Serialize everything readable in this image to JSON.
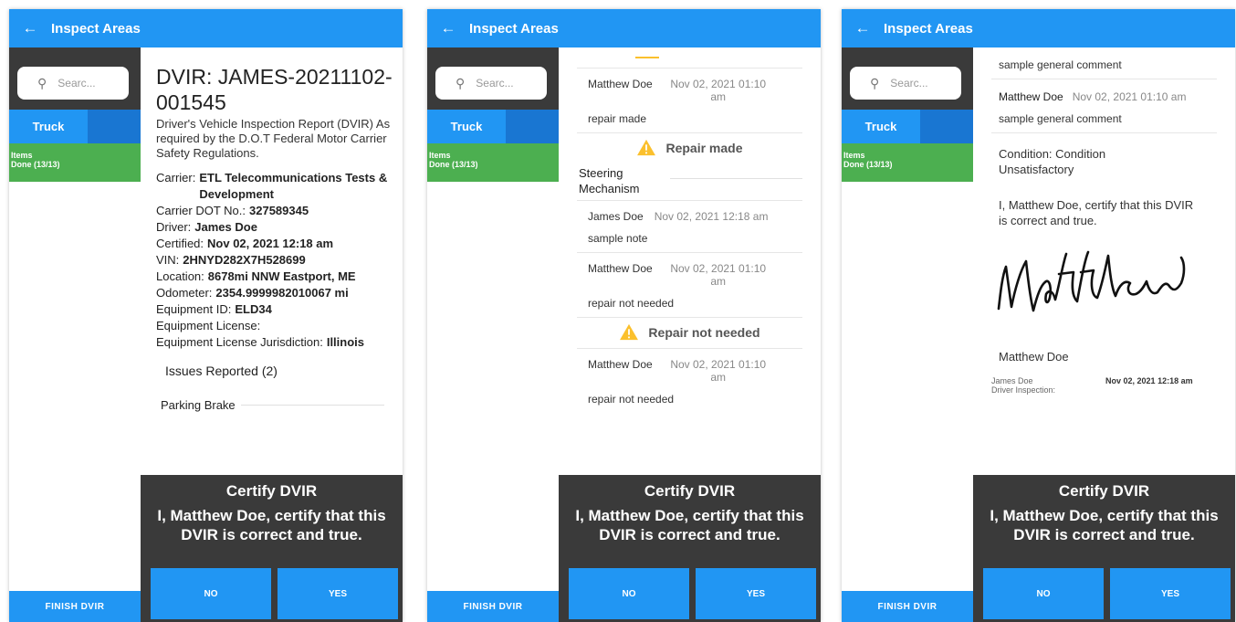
{
  "app": {
    "title": "Inspect Areas",
    "search_placeholder": "Searc...",
    "tab_truck": "Truck",
    "items_label": "Items",
    "items_done": "Done (13/13)",
    "finish_label": "FINISH DVIR"
  },
  "certify": {
    "title": "Certify DVIR",
    "text": "I, Matthew Doe, certify that this DVIR is correct and true.",
    "no_label": "NO",
    "yes_label": "YES"
  },
  "phone1": {
    "title": "DVIR: JAMES-20211102-001545",
    "subtitle": "Driver's Vehicle Inspection Report (DVIR) As required by the D.O.T Federal Motor Carrier Safety Regulations.",
    "details": [
      {
        "label": "Carrier:",
        "value": "ETL Telecommunications Tests & Development"
      },
      {
        "label": "Carrier DOT No.:",
        "value": "327589345"
      },
      {
        "label": "Driver:",
        "value": "James Doe"
      },
      {
        "label": "Certified:",
        "value": "Nov 02, 2021  12:18 am"
      },
      {
        "label": "VIN:",
        "value": "2HNYD282X7H528699"
      },
      {
        "label": "Location:",
        "value": "8678mi NNW Eastport, ME"
      },
      {
        "label": "Odometer:",
        "value": "2354.9999982010067 mi"
      },
      {
        "label": "Equipment ID:",
        "value": "ELD34"
      },
      {
        "label": "Equipment License:",
        "value": ""
      },
      {
        "label": "Equipment License Jurisdiction:",
        "value": "Illinois"
      }
    ],
    "issues_heading": "Issues Reported (2)",
    "first_issue": "Parking Brake"
  },
  "phone2": {
    "entries": [
      {
        "author": "Matthew Doe",
        "date": "Nov 02, 2021 01:10 am",
        "body": "repair made"
      },
      {
        "author": "James Doe",
        "date": "Nov 02, 2021 12:18 am",
        "body": "sample note"
      },
      {
        "author": "Matthew Doe",
        "date": "Nov 02, 2021 01:10 am",
        "body": "repair not needed"
      },
      {
        "author": "Matthew Doe",
        "date": "Nov 02, 2021 01:10 am",
        "body": "repair not needed"
      }
    ],
    "status_repair_made": "Repair made",
    "status_repair_not_needed": "Repair not needed",
    "issue_steering": "Steering Mechanism",
    "warning_color": "#fbc02d"
  },
  "phone3": {
    "general_comment": "sample general comment",
    "comment_author": "Matthew Doe",
    "comment_date": "Nov 02, 2021 01:10 am",
    "comment_body": "sample general comment",
    "condition": "Condition: Condition Unsatisfactory",
    "certify_statement": "I, Matthew Doe, certify that this DVIR is correct and true.",
    "signer_name": "Matthew Doe",
    "driver_name": "James Doe",
    "driver_label": "Driver Inspection:",
    "driver_date": "Nov 02, 2021  12:18 am"
  },
  "colors": {
    "primary": "#2196f3",
    "green": "#4caf50",
    "dark": "#3a3a3a"
  }
}
